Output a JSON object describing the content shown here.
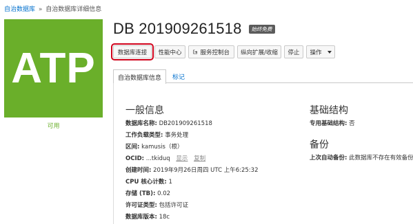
{
  "breadcrumb": {
    "root": "自治数据库",
    "separator": "»",
    "current": "自治数据库详细信息"
  },
  "logo": {
    "text": "ATP",
    "color": "#6aaf2a"
  },
  "status": "可用",
  "title": "DB 201909261518",
  "badge": "始终免费",
  "toolbar": {
    "db_connection": "数据库连接",
    "performance_hub": "性能中心",
    "service_console": "服务控制台",
    "scale": "纵向扩展/收缩",
    "stop": "停止",
    "actions": "操作"
  },
  "tabs": {
    "info": "自治数据库信息",
    "tags": "标记"
  },
  "general": {
    "heading": "一般信息",
    "rows": [
      {
        "label": "数据库名称:",
        "value": "DB201909261518"
      },
      {
        "label": "工作负载类型:",
        "value": "事务处理"
      },
      {
        "label": "区间:",
        "value": "kamusis（根）"
      },
      {
        "label": "OCID:",
        "value": "...tkiduq",
        "show": "显示",
        "copy": "复制"
      },
      {
        "label": "创建时间:",
        "value": "2019年9月26日周四 UTC 上午6:25:32"
      },
      {
        "label": "CPU 核心计数:",
        "value": "1"
      },
      {
        "label": "存储 (TB):",
        "value": "0.02"
      },
      {
        "label": "许可证类型:",
        "value": "包括许可证"
      },
      {
        "label": "数据库版本:",
        "value": "18c"
      }
    ]
  },
  "infrastructure": {
    "heading": "基础结构",
    "label": "专用基础结构:",
    "value": "否"
  },
  "backup": {
    "heading": "备份",
    "label": "上次自动备份:",
    "value": "此数据库不存在有效备份。"
  }
}
